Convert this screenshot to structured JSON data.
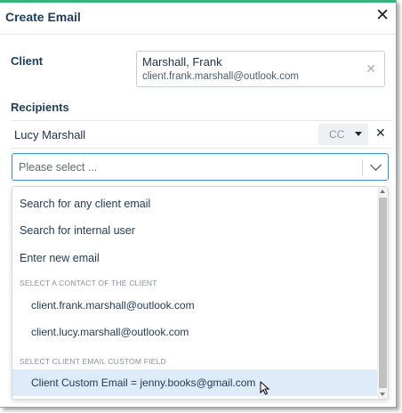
{
  "dialog": {
    "title": "Create Email",
    "close_glyph": "✕"
  },
  "client": {
    "label": "Client",
    "name": "Marshall, Frank",
    "email": "client.frank.marshall@outlook.com",
    "clear_glyph": "✕"
  },
  "recipients": {
    "label": "Recipients",
    "rows": [
      {
        "name": "Lucy Marshall",
        "type": "CC",
        "remove_glyph": "✕"
      }
    ]
  },
  "select": {
    "placeholder": "Please select ..."
  },
  "dropdown": {
    "options": [
      "Search for any client email",
      "Search for internal user",
      "Enter new email"
    ],
    "group_contact": {
      "heading": "SELECT A CONTACT OF THE CLIENT",
      "items": [
        "client.frank.marshall@outlook.com",
        "client.lucy.marshall@outlook.com"
      ]
    },
    "group_custom": {
      "heading": "SELECT CLIENT EMAIL CUSTOM FIELD",
      "items": [
        "Client Custom Email = jenny.books@gmail.com"
      ]
    }
  },
  "colors": {
    "accent_top": "#3ab37a",
    "focus_border": "#3b8fd9",
    "highlight": "#deebf8"
  }
}
